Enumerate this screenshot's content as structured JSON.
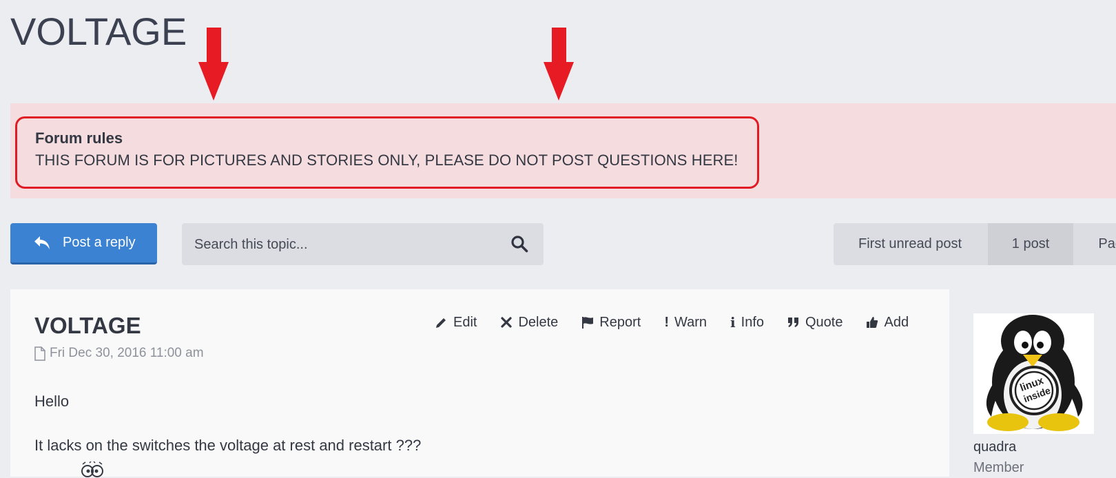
{
  "topic": {
    "title": "VOLTAGE"
  },
  "annotations": {
    "arrow_color": "#e61b24",
    "highlight_color": "#e01b24"
  },
  "forum_rules": {
    "title": "Forum rules",
    "text": "THIS FORUM IS FOR PICTURES AND STORIES ONLY, PLEASE DO NOT POST QUESTIONS HERE!"
  },
  "toolbar": {
    "reply_label": "Post a reply",
    "search_placeholder": "Search this topic...",
    "accent": "#3b82d3"
  },
  "pagination": {
    "first_unread": "First unread post",
    "post_count": "1 post",
    "page_label": "Pag"
  },
  "post": {
    "title": "VOLTAGE",
    "date": "Fri Dec 30, 2016 11:00 am",
    "actions": [
      "Edit",
      "Delete",
      "Report",
      "Warn",
      "Info",
      "Quote",
      "Add"
    ],
    "body": [
      "Hello",
      "It lacks on the switches the voltage at rest and restart ???"
    ]
  },
  "author": {
    "username": "quadra",
    "rank": "Member",
    "avatar_text_1": "linux",
    "avatar_text_2": "inside"
  }
}
